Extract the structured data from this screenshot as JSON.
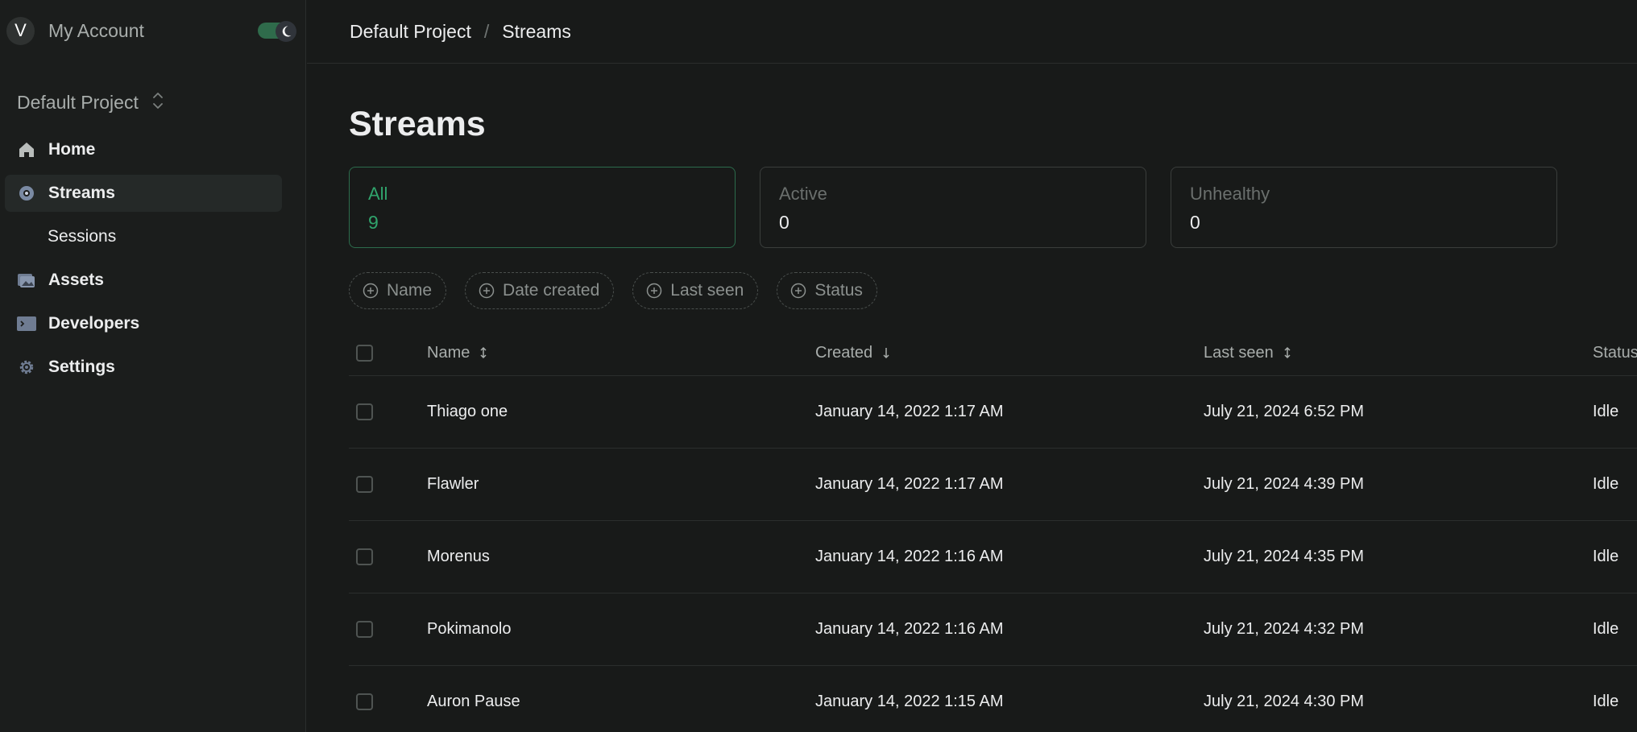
{
  "sidebar": {
    "avatar_letter": "V",
    "account_name": "My Account",
    "project_name": "Default Project",
    "nav": [
      {
        "label": "Home",
        "icon": "home-icon"
      },
      {
        "label": "Streams",
        "icon": "streams-icon",
        "active": true
      },
      {
        "label": "Sessions",
        "sub": true
      },
      {
        "label": "Assets",
        "icon": "assets-icon"
      },
      {
        "label": "Developers",
        "icon": "terminal-icon"
      },
      {
        "label": "Settings",
        "icon": "gear-icon"
      }
    ]
  },
  "breadcrumb": {
    "project": "Default Project",
    "separator": "/",
    "page": "Streams"
  },
  "page_title": "Streams",
  "stats": [
    {
      "label": "All",
      "count": "9",
      "selected": true
    },
    {
      "label": "Active",
      "count": "0"
    },
    {
      "label": "Unhealthy",
      "count": "0"
    }
  ],
  "filters": [
    "Name",
    "Date created",
    "Last seen",
    "Status"
  ],
  "table": {
    "headers": {
      "name": "Name",
      "created": "Created",
      "last_seen": "Last seen",
      "status": "Status"
    },
    "rows": [
      {
        "name": "Thiago one",
        "created": "January 14, 2022 1:17 AM",
        "last_seen": "July 21, 2024 6:52 PM",
        "status": "Idle"
      },
      {
        "name": "Flawler",
        "created": "January 14, 2022 1:17 AM",
        "last_seen": "July 21, 2024 4:39 PM",
        "status": "Idle"
      },
      {
        "name": "Morenus",
        "created": "January 14, 2022 1:16 AM",
        "last_seen": "July 21, 2024 4:35 PM",
        "status": "Idle"
      },
      {
        "name": "Pokimanolo",
        "created": "January 14, 2022 1:16 AM",
        "last_seen": "July 21, 2024 4:32 PM",
        "status": "Idle"
      },
      {
        "name": "Auron Pause",
        "created": "January 14, 2022 1:15 AM",
        "last_seen": "July 21, 2024 4:30 PM",
        "status": "Idle"
      }
    ]
  },
  "colors": {
    "accent": "#30a46c",
    "background": "#181a19",
    "sidebar": "#1b1d1c"
  }
}
